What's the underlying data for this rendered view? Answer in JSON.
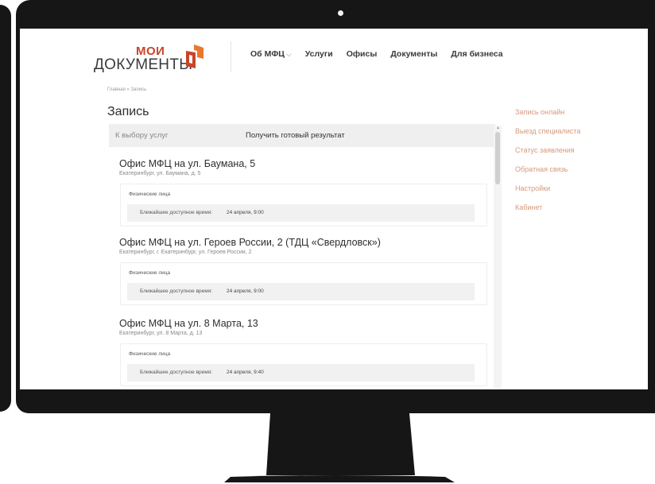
{
  "header": {
    "logo_top": "МОИ",
    "logo_bottom": "ДОКУМЕНТЫ",
    "nav": [
      {
        "label": "Об МФЦ",
        "chevron": "⌵"
      },
      {
        "label": "Услуги"
      },
      {
        "label": "Офисы"
      },
      {
        "label": "Документы"
      },
      {
        "label": "Для бизнеса"
      }
    ]
  },
  "breadcrumb": "Главная » Запись",
  "page_title": "Запись",
  "tabs": {
    "back": "К выбору услуг",
    "result": "Получить готовый результат"
  },
  "offices": [
    {
      "title": "Офис МФЦ на ул. Баумана, 5",
      "address": "Екатеринбург, ул. Баумана, д. 5",
      "category": "Физические лица",
      "slot_label": "Ближайшее доступное время:",
      "slot_time": "24 апреля, 9:00"
    },
    {
      "title": "Офис МФЦ на ул. Героев России, 2 (ТДЦ «Свердловск»)",
      "address": "Екатеринбург, г. Екатеринбург, ул. Героев России, 2",
      "category": "Физические лица",
      "slot_label": "Ближайшее доступное время:",
      "slot_time": "24 апреля, 9:00"
    },
    {
      "title": "Офис МФЦ на ул. 8 Марта, 13",
      "address": "Екатеринбург, ул. 8 Марта, д. 13",
      "category": "Физические лица",
      "slot_label": "Ближайшее доступное время:",
      "slot_time": "24 апреля, 9:40"
    }
  ],
  "sidebar": {
    "items": [
      {
        "label": "Запись онлайн"
      },
      {
        "label": "Выезд специалиста"
      },
      {
        "label": "Статус заявления"
      },
      {
        "label": "Обратная связь"
      },
      {
        "label": "Настройки"
      },
      {
        "label": "Кабинет"
      }
    ]
  },
  "colors": {
    "brand_red": "#c7452a",
    "brand_orange": "#e8782f",
    "sidebar_link": "#d59a7c",
    "bezel": "#161616"
  },
  "icons": {
    "logo_mark": "moi-dokumenty-logo-icon",
    "scroll_up": "scroll-up-arrow-icon",
    "nav_dropdown": "chevron-down-icon"
  }
}
